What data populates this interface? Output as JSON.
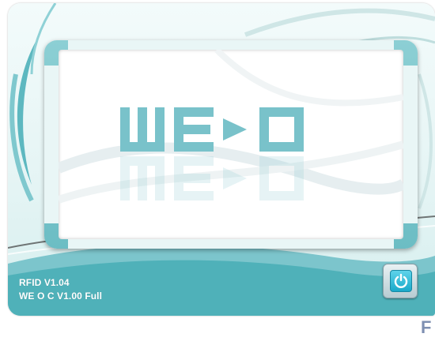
{
  "splash": {
    "logo_text": "WE O",
    "rfid_version": "RFID V1.04",
    "weoc_version": "WE O C V1.00 Full",
    "power_icon": "power-icon",
    "corner_text": "F"
  },
  "colors": {
    "teal": "#6cbdc4",
    "teal_light": "#8ccfd4",
    "logo": "#79c2ca",
    "background": "#e4f4f4",
    "power_blue": "#1aa9c9"
  }
}
